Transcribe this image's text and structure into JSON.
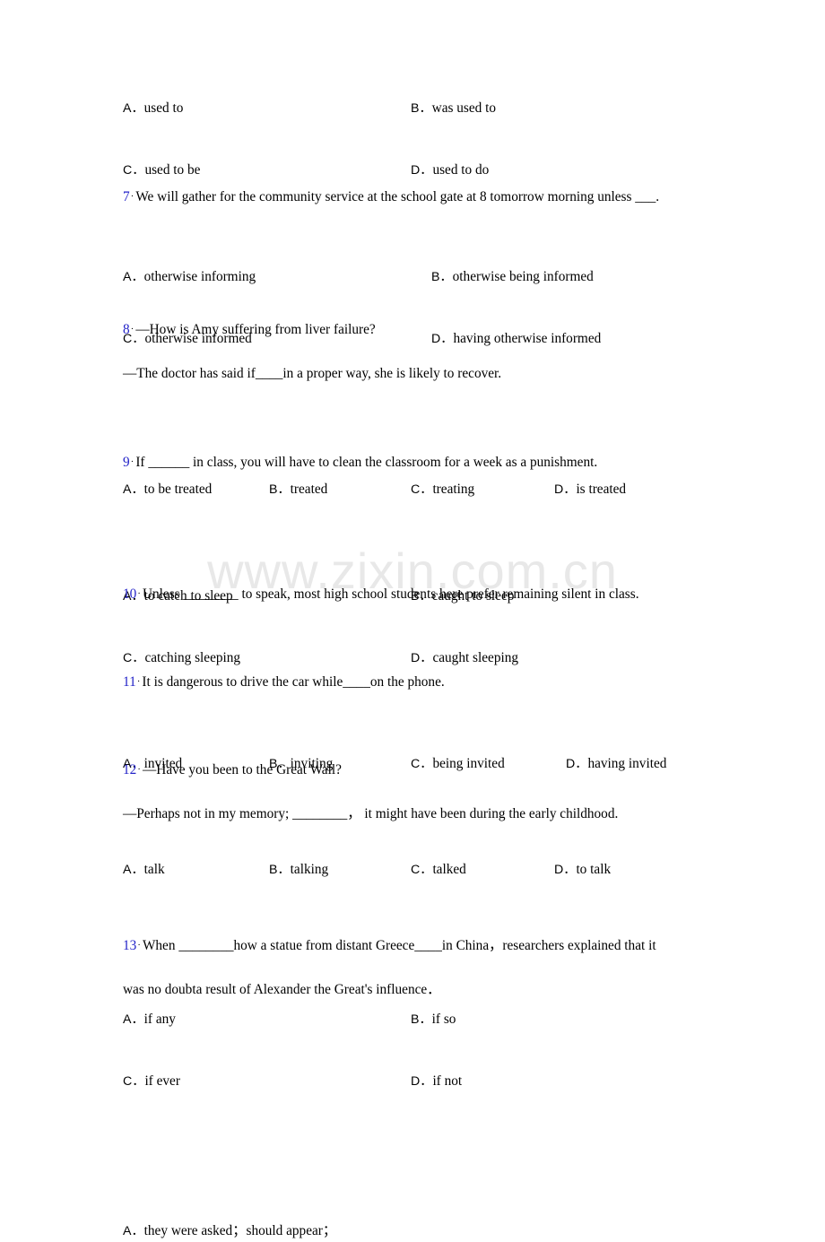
{
  "document": {
    "watermark": "www.zixin.com.cn",
    "number_color": "#2323c8",
    "text_color": "#000000",
    "background_color": "#ffffff"
  },
  "q6_options": {
    "a_letter": "A．",
    "a_text": "used to",
    "b_letter": "B．",
    "b_text": "was used to",
    "c_letter": "C．",
    "c_text": "used to be",
    "d_letter": "D．",
    "d_text": "used to do"
  },
  "q7": {
    "number": "7",
    "sep": "·",
    "stem": "We will gather for the community service at the school gate at 8 tomorrow morning unless ___.",
    "a_letter": "A．",
    "a_text": "otherwise informing",
    "b_letter": "B．",
    "b_text": "otherwise being informed",
    "c_letter": "C．",
    "c_text": "otherwise informed",
    "d_letter": "D．",
    "d_text": "having otherwise informed"
  },
  "q8": {
    "number": "8",
    "sep": "·",
    "stem": "—How is  Amy suffering from liver failure?",
    "stem2": "—The doctor has said if____in a proper way, she is likely to recover.",
    "a_letter": "A．",
    "a_text": "to be treated",
    "b_letter": "B．",
    "b_text": "treated",
    "c_letter": "C．",
    "c_text": "treating",
    "d_letter": "D．",
    "d_text": "is treated"
  },
  "q9": {
    "number": "9",
    "sep": "·",
    "stem": "If ______  in class, you will have to clean the classroom for a week as a punishment.",
    "a_letter": "A．",
    "a_text": "to catch to sleep",
    "b_letter": "B．",
    "b_text": "caught to sleep",
    "c_letter": "C．",
    "c_text": "catching sleeping",
    "d_letter": "D．",
    "d_text": "caught sleeping"
  },
  "q10": {
    "number": "10",
    "sep": "·",
    "stem": "Unless ________ to speak, most high school students here prefer remaining silent in class.",
    "a_letter": "A．",
    "a_text": "invited",
    "b_letter": "B．",
    "b_text": "inviting",
    "c_letter": "C．",
    "c_text": "being invited",
    "d_letter": "D．",
    "d_text": "having invited"
  },
  "q11": {
    "number": "11",
    "sep": "·",
    "stem": "It is dangerous to drive the car while____on the phone.",
    "a_letter": "A．",
    "a_text": "talk",
    "b_letter": "B．",
    "b_text": "talking",
    "c_letter": "C．",
    "c_text": "talked",
    "d_letter": "D．",
    "d_text": "to talk"
  },
  "q12": {
    "number": "12",
    "sep": "·",
    "stem": "—Have you been to the Great Wall?",
    "stem2": "—Perhaps not in my memory; ________，  it might have been during the early childhood.",
    "a_letter": "A．",
    "a_text": "if any",
    "b_letter": "B．",
    "b_text": "if so",
    "c_letter": "C．",
    "c_text": "if ever",
    "d_letter": "D．",
    "d_text": "if not"
  },
  "q13": {
    "number": "13",
    "sep": "·",
    "stem": "When ________how a statue from distant Greece____in China，researchers explained that it",
    "stem2": "was no doubta result of Alexander the Great's influence．",
    "a_letter": "A．",
    "a_text": "they were asked；should appear；"
  }
}
